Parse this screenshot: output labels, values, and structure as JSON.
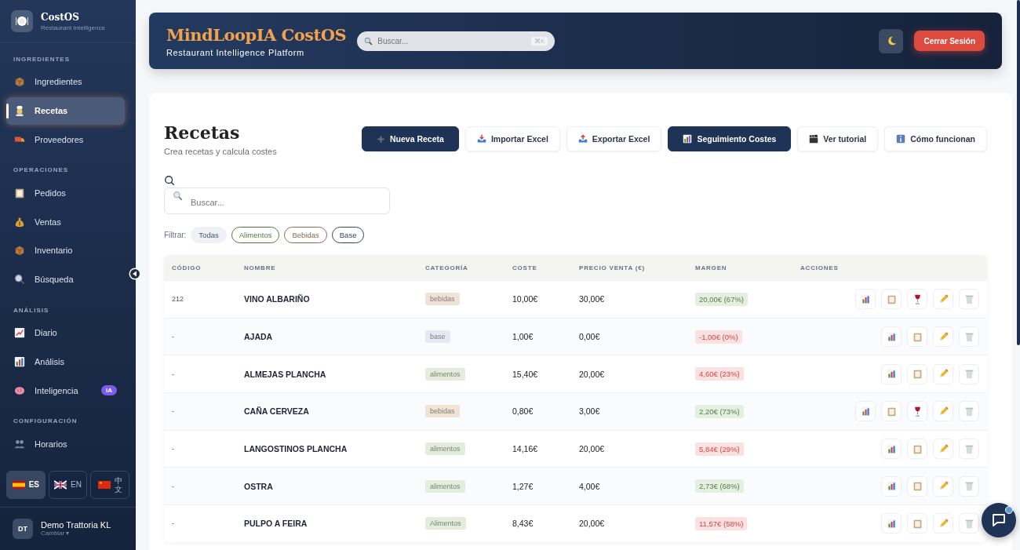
{
  "sidebar": {
    "brand": {
      "name": "CostOS",
      "tagline": "Restaurant Intelligence"
    },
    "sections": [
      {
        "title": "INGREDIENTES",
        "items": [
          {
            "label": "Ingredientes",
            "selected": false
          },
          {
            "label": "Recetas",
            "selected": true
          },
          {
            "label": "Proveedores",
            "selected": false
          }
        ]
      },
      {
        "title": "OPERACIONES",
        "items": [
          {
            "label": "Pedidos",
            "selected": false
          },
          {
            "label": "Ventas",
            "selected": false
          },
          {
            "label": "Inventario",
            "selected": false
          },
          {
            "label": "Búsqueda",
            "selected": false
          }
        ]
      },
      {
        "title": "ANÁLISIS",
        "items": [
          {
            "label": "Diario",
            "selected": false
          },
          {
            "label": "Análisis",
            "selected": false
          },
          {
            "label": "Inteligencia",
            "selected": false,
            "badge": "IA"
          }
        ]
      },
      {
        "title": "CONFIGURACIÓN",
        "items": [
          {
            "label": "Horarios",
            "selected": false
          }
        ]
      }
    ],
    "languages": [
      {
        "label": "ES",
        "selected": true
      },
      {
        "label": "EN",
        "selected": false
      },
      {
        "label": "中文",
        "selected": false
      }
    ],
    "account": {
      "initials": "DT",
      "name": "Demo Trattoria KL",
      "action": "Cambiar ▾"
    }
  },
  "header": {
    "title": "MindLoopIA CostOS",
    "subtitle": "Restaurant Intelligence Platform",
    "search": {
      "placeholder": "Buscar...",
      "shortcut": "⌘K"
    },
    "logout": "Cerrar Sesión"
  },
  "page": {
    "title": "Recetas",
    "subtitle": "Crea recetas y calcula costes",
    "actions": [
      {
        "label": "Nueva Receta",
        "primary": true
      },
      {
        "label": "Importar Excel",
        "primary": false
      },
      {
        "label": "Exportar Excel",
        "primary": false
      },
      {
        "label": "Seguimiento Costes",
        "primary": true
      },
      {
        "label": "Ver tutorial",
        "primary": false
      },
      {
        "label": "Cómo funcionan",
        "primary": false
      }
    ],
    "search": {
      "placeholder": "Buscar..."
    },
    "filter_label": "Filtrar:",
    "filters": [
      {
        "label": "Todas",
        "selected": true,
        "color": "#eef1f6"
      },
      {
        "label": "Alimentos",
        "selected": false,
        "color": "#4f7a3e"
      },
      {
        "label": "Bebidas",
        "selected": false,
        "color": "#8a6a4a"
      },
      {
        "label": "Base",
        "selected": false,
        "color": "#33415f"
      }
    ]
  },
  "table": {
    "columns": [
      "CÓDIGO",
      "NOMBRE",
      "CATEGORÍA",
      "COSTE",
      "PRECIO VENTA (€)",
      "MARGEN",
      "ACCIONES"
    ],
    "rows": [
      {
        "code": "212",
        "name": "VINO ALBARIÑO",
        "category": {
          "label": "bebidas",
          "color": "#efe3d6"
        },
        "cost": "10,00€",
        "price": "30,00€",
        "margin": {
          "label": "20,00€ (67%)",
          "negative": false
        },
        "actions": [
          {
            "kind": "chart"
          },
          {
            "kind": "notes"
          },
          {
            "kind": "wine"
          },
          {
            "kind": "edit"
          },
          {
            "kind": "delete"
          }
        ]
      },
      {
        "code": "-",
        "name": "AJADA",
        "category": {
          "label": "base",
          "color": "#e6e9f1"
        },
        "cost": "1,00€",
        "price": "0,00€",
        "margin": {
          "label": "-1,00€ (0%)",
          "negative": true
        },
        "actions": [
          {
            "kind": "chart"
          },
          {
            "kind": "notes"
          },
          {
            "kind": "edit"
          },
          {
            "kind": "delete"
          }
        ]
      },
      {
        "code": "-",
        "name": "ALMEJAS PLANCHA",
        "category": {
          "label": "alimentos",
          "color": "#e4eddc"
        },
        "cost": "15,40€",
        "price": "20,00€",
        "margin": {
          "label": "4,60€ (23%)",
          "negative": true
        },
        "actions": [
          {
            "kind": "chart"
          },
          {
            "kind": "notes"
          },
          {
            "kind": "edit"
          },
          {
            "kind": "delete"
          }
        ]
      },
      {
        "code": "-",
        "name": "CAÑA CERVEZA",
        "category": {
          "label": "bebidas",
          "color": "#efe3d6"
        },
        "cost": "0,80€",
        "price": "3,00€",
        "margin": {
          "label": "2,20€ (73%)",
          "negative": false
        },
        "actions": [
          {
            "kind": "chart"
          },
          {
            "kind": "notes"
          },
          {
            "kind": "wine"
          },
          {
            "kind": "edit"
          },
          {
            "kind": "delete"
          }
        ]
      },
      {
        "code": "-",
        "name": "LANGOSTINOS PLANCHA",
        "category": {
          "label": "alimentos",
          "color": "#e4eddc"
        },
        "cost": "14,16€",
        "price": "20,00€",
        "margin": {
          "label": "5,84€ (29%)",
          "negative": true
        },
        "actions": [
          {
            "kind": "chart"
          },
          {
            "kind": "notes"
          },
          {
            "kind": "edit"
          },
          {
            "kind": "delete"
          }
        ]
      },
      {
        "code": "-",
        "name": "OSTRA",
        "category": {
          "label": "alimentos",
          "color": "#e4eddc"
        },
        "cost": "1,27€",
        "price": "4,00€",
        "margin": {
          "label": "2,73€ (68%)",
          "negative": false
        },
        "actions": [
          {
            "kind": "chart"
          },
          {
            "kind": "notes"
          },
          {
            "kind": "edit"
          },
          {
            "kind": "delete"
          }
        ]
      },
      {
        "code": "-",
        "name": "PULPO A FEIRA",
        "category": {
          "label": "Alimentos",
          "color": "#e4eddc"
        },
        "cost": "8,43€",
        "price": "20,00€",
        "margin": {
          "label": "11,57€ (58%)",
          "negative": true
        },
        "actions": [
          {
            "kind": "chart"
          },
          {
            "kind": "notes"
          },
          {
            "kind": "edit"
          },
          {
            "kind": "delete"
          }
        ]
      }
    ]
  }
}
